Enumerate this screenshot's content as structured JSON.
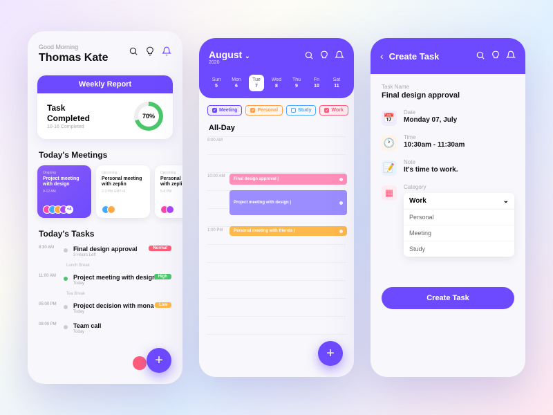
{
  "home": {
    "greeting": "Good Morning",
    "name": "Thomas Kate",
    "report": {
      "title": "Weekly Report",
      "heading": "Task\nCompleted",
      "sub": "10-16 Completed",
      "percent": "70%"
    },
    "meetings_title": "Today's Meetings",
    "meetings": [
      {
        "status": "Ongoing",
        "title": "Project meeting with design",
        "time": "9-12 AM",
        "more": "+4"
      },
      {
        "status": "Upcoming",
        "title": "Personal meeting with zeplin",
        "time": "2-3 PM GMT+6"
      },
      {
        "status": "Upcoming",
        "title": "Personal meeting with zeplin",
        "time": "5-6 PM"
      }
    ],
    "tasks_title": "Today's Tasks",
    "tasks": [
      {
        "time": "8:30 AM",
        "title": "Final design approval",
        "sub": "3 Hours Left",
        "badge": "Normal"
      },
      {
        "break": "Lunch Break"
      },
      {
        "time": "11:00 AM",
        "title": "Project meeting with design",
        "sub": "Today",
        "badge": "High"
      },
      {
        "break": "Tea Break"
      },
      {
        "time": "05:00 PM",
        "title": "Project decision with mona",
        "sub": "Today",
        "badge": "Low"
      },
      {
        "time": "08:00 PM",
        "title": "Team call",
        "sub": "Today"
      }
    ]
  },
  "calendar": {
    "month": "August",
    "year": "2020",
    "days": [
      {
        "name": "Sun",
        "num": "5"
      },
      {
        "name": "Mon",
        "num": "6"
      },
      {
        "name": "Tue",
        "num": "7",
        "active": true
      },
      {
        "name": "Wed",
        "num": "8"
      },
      {
        "name": "Thu",
        "num": "9"
      },
      {
        "name": "Fri",
        "num": "10"
      },
      {
        "name": "Sat",
        "num": "11"
      }
    ],
    "tags": [
      {
        "label": "Meeting",
        "checked": true
      },
      {
        "label": "Personal",
        "checked": true
      },
      {
        "label": "Study",
        "checked": false
      },
      {
        "label": "Work",
        "checked": true
      }
    ],
    "allday": "All-Day",
    "hours": [
      "8:00 AM",
      "",
      "10:00 AM",
      "",
      "",
      "1:00 PM",
      "",
      "",
      "",
      "",
      "",
      ""
    ],
    "events": [
      {
        "title": "Final design approval |",
        "class": "ev-pink"
      },
      {
        "title": "Project meeting with design |",
        "class": "ev-purple"
      },
      {
        "title": "Personal meeting with friends |",
        "class": "ev-orange"
      }
    ]
  },
  "create": {
    "title": "Create Task",
    "name_label": "Task Name",
    "name_value": "Final design approval",
    "fields": [
      {
        "label": "Date",
        "value": "Monday 07, July"
      },
      {
        "label": "Time",
        "value": "10:30am - 11:30am"
      },
      {
        "label": "Note",
        "value": "It's time to work."
      },
      {
        "label": "Category",
        "value": "Work"
      }
    ],
    "category_options": [
      "Personal",
      "Meeting",
      "Study"
    ],
    "button": "Create Task"
  }
}
